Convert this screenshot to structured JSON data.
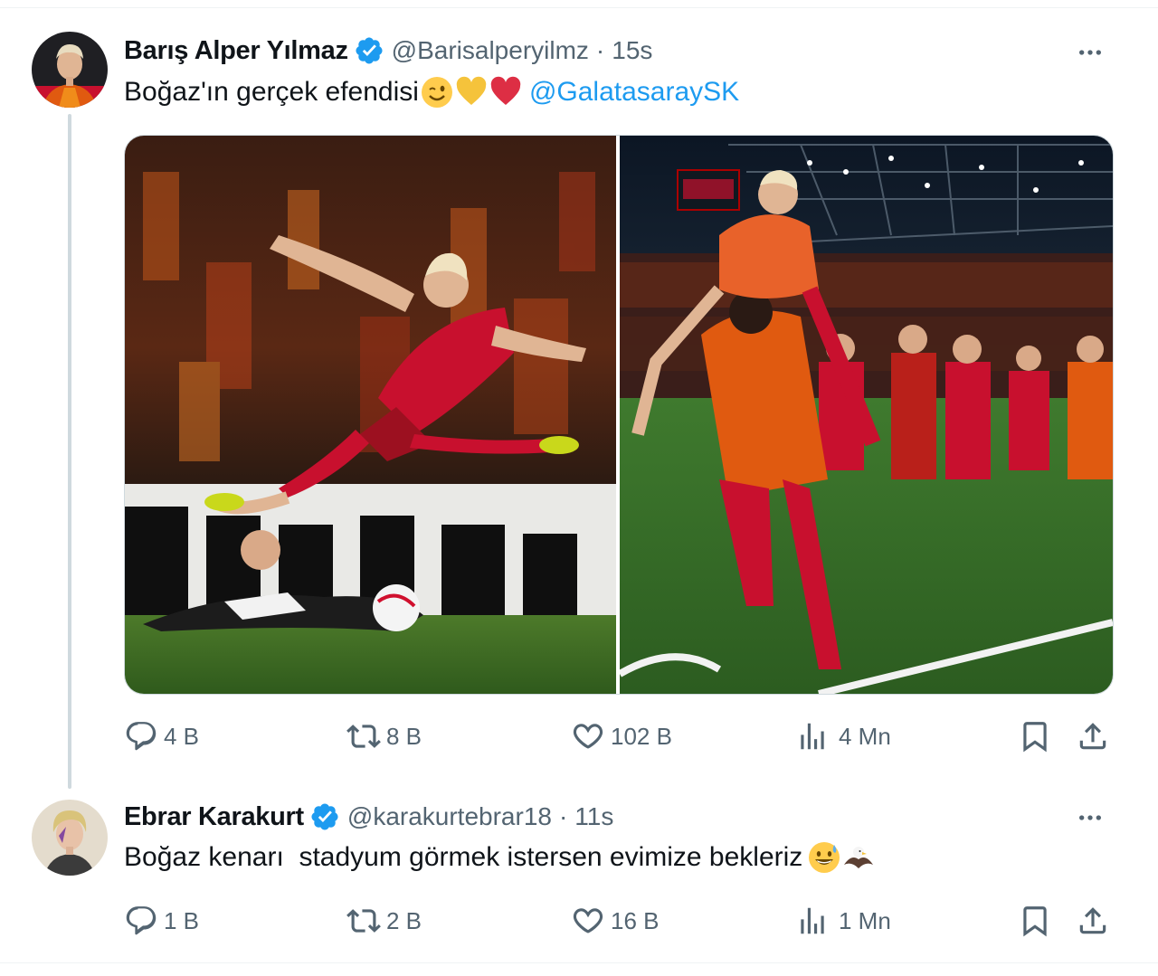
{
  "tweets": [
    {
      "display_name": "Barış Alper Yılmaz",
      "handle": "@Barisalperyilmz",
      "time": "15s",
      "text": "Boğaz'ın gerçek efendisi",
      "emojis": [
        "winking-face",
        "yellow-heart",
        "red-heart"
      ],
      "mention": "@GalatasaraySK",
      "photos": [
        "Player in red-orange kit leaping over a sliding opponent",
        "Players in red-orange kit celebrating in a stadium"
      ],
      "stats": {
        "replies": "4 B",
        "retweets": "8 B",
        "likes": "102 B",
        "views": "4 Mn"
      }
    },
    {
      "display_name": "Ebrar Karakurt",
      "handle": "@karakurtebrar18",
      "time": "11s",
      "text": "Boğaz kenarı  stadyum görmek istersen evimize bekleriz",
      "emojis": [
        "grinning-sweat-face",
        "eagle"
      ],
      "stats": {
        "replies": "1 B",
        "retweets": "2 B",
        "likes": "16 B",
        "views": "1 Mn"
      }
    }
  ],
  "colors": {
    "link": "#1d9bf0",
    "secondary": "#536471",
    "verified": "#1d9bf0",
    "heart": "#e0243c",
    "yellow_heart": "#f5c33b"
  }
}
